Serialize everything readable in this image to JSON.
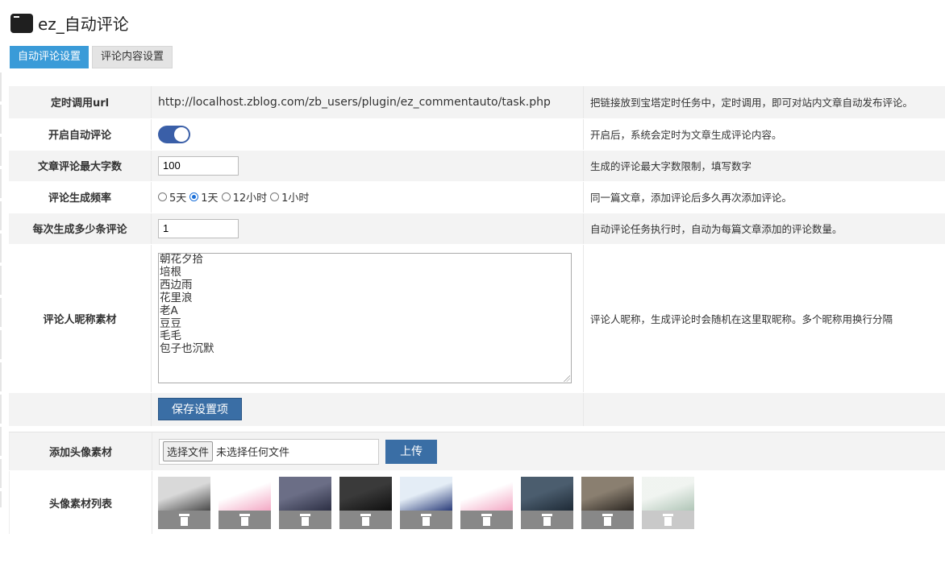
{
  "header": {
    "title": "ez_自动评论"
  },
  "tabs": [
    {
      "label": "自动评论设置"
    },
    {
      "label": "评论内容设置"
    }
  ],
  "rows": {
    "url": {
      "label": "定时调用url",
      "value": "http://localhost.zblog.com/zb_users/plugin/ez_commentauto/task.php",
      "desc": "把链接放到宝塔定时任务中，定时调用，即可对站内文章自动发布评论。"
    },
    "enable": {
      "label": "开启自动评论",
      "on": true,
      "desc": "开启后，系统会定时为文章生成评论内容。"
    },
    "maxlen": {
      "label": "文章评论最大字数",
      "value": "100",
      "desc": "生成的评论最大字数限制，填写数字"
    },
    "freq": {
      "label": "评论生成频率",
      "options": [
        "5天",
        "1天",
        "12小时",
        "1小时"
      ],
      "selected": "1天",
      "desc": "同一篇文章，添加评论后多久再次添加评论。"
    },
    "count": {
      "label": "每次生成多少条评论",
      "value": "1",
      "desc": "自动评论任务执行时，自动为每篇文章添加的评论数量。"
    },
    "nicknames": {
      "label": "评论人昵称素材",
      "lines": [
        "朝花夕拾",
        "培根",
        "西边雨",
        "花里浪",
        "老A",
        "豆豆",
        "毛毛",
        "包子也沉默"
      ],
      "desc": "评论人昵称，生成评论时会随机在这里取昵称。多个昵称用换行分隔"
    }
  },
  "save_button": "保存设置项",
  "avatar_upload": {
    "label": "添加头像素材",
    "choose_label": "选择文件",
    "status": "未选择任何文件",
    "upload_label": "上传"
  },
  "avatar_list": {
    "label": "头像素材列表",
    "items": [
      {
        "name": "avatar-boy",
        "colors": [
          "#d9d9d9",
          "#4a4a4a"
        ]
      },
      {
        "name": "avatar-cow-pig",
        "colors": [
          "#ffffff",
          "#f3a8c4"
        ]
      },
      {
        "name": "avatar-couple",
        "colors": [
          "#6b6e86",
          "#2c2f44"
        ]
      },
      {
        "name": "avatar-dark",
        "colors": [
          "#3a3a3a",
          "#0f0f0f"
        ]
      },
      {
        "name": "avatar-comic",
        "colors": [
          "#e4edf6",
          "#2a3c7a"
        ]
      },
      {
        "name": "avatar-cow-pig-2",
        "colors": [
          "#ffffff",
          "#f3a8c4"
        ]
      },
      {
        "name": "avatar-man",
        "colors": [
          "#4b5d6e",
          "#1e2a36"
        ]
      },
      {
        "name": "avatar-room",
        "colors": [
          "#8a7f70",
          "#2b2621"
        ]
      },
      {
        "name": "avatar-z-logo",
        "colors": [
          "#dfe7df",
          "#4f7f5f"
        ]
      }
    ]
  }
}
